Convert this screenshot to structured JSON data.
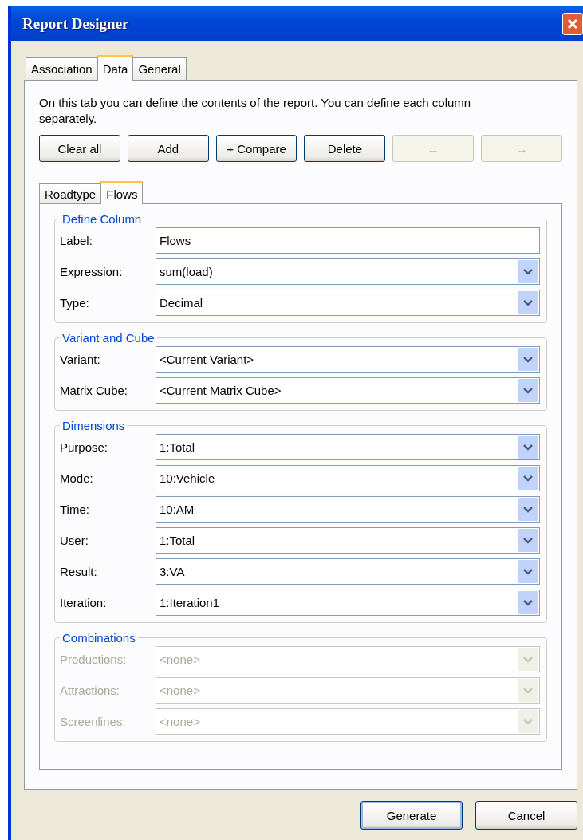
{
  "window": {
    "title": "Report Designer"
  },
  "tabs": [
    {
      "label": "Association",
      "selected": false
    },
    {
      "label": "Data",
      "selected": true
    },
    {
      "label": "General",
      "selected": false
    }
  ],
  "description": "On this tab you can define the contents of the report. You can define each column separately.",
  "toolbar": [
    {
      "label": "Clear all",
      "disabled": false
    },
    {
      "label": "Add",
      "disabled": false
    },
    {
      "label": "+ Compare",
      "disabled": false
    },
    {
      "label": "Delete",
      "disabled": false
    },
    {
      "label": "←",
      "disabled": true
    },
    {
      "label": "→",
      "disabled": true
    }
  ],
  "inner_tabs": [
    {
      "label": "Roadtype",
      "selected": false
    },
    {
      "label": "Flows",
      "selected": true
    }
  ],
  "groups": [
    {
      "title": "Define Column",
      "disabled": false,
      "fields": [
        {
          "label": "Label:",
          "kind": "text",
          "value": "Flows"
        },
        {
          "label": "Expression:",
          "kind": "dropdown",
          "value": "sum(load)"
        },
        {
          "label": "Type:",
          "kind": "dropdown",
          "value": "Decimal"
        }
      ]
    },
    {
      "title": "Variant and Cube",
      "disabled": false,
      "fields": [
        {
          "label": "Variant:",
          "kind": "dropdown",
          "value": "<Current Variant>"
        },
        {
          "label": "Matrix Cube:",
          "kind": "dropdown",
          "value": "<Current Matrix Cube>"
        }
      ]
    },
    {
      "title": "Dimensions",
      "disabled": false,
      "fields": [
        {
          "label": "Purpose:",
          "kind": "dropdown",
          "value": "1:Total"
        },
        {
          "label": "Mode:",
          "kind": "dropdown",
          "value": "10:Vehicle"
        },
        {
          "label": "Time:",
          "kind": "dropdown",
          "value": "10:AM"
        },
        {
          "label": "User:",
          "kind": "dropdown",
          "value": "1:Total"
        },
        {
          "label": "Result:",
          "kind": "dropdown",
          "value": "3:VA"
        },
        {
          "label": "Iteration:",
          "kind": "dropdown",
          "value": "1:Iteration1"
        }
      ]
    },
    {
      "title": "Combinations",
      "disabled": true,
      "fields": [
        {
          "label": "Productions:",
          "kind": "dropdown",
          "value": "<none>"
        },
        {
          "label": "Attractions:",
          "kind": "dropdown",
          "value": "<none>"
        },
        {
          "label": "Screenlines:",
          "kind": "dropdown",
          "value": "<none>"
        }
      ]
    }
  ],
  "buttons": [
    {
      "label": "Generate",
      "default": true
    },
    {
      "label": "Cancel",
      "default": false
    }
  ]
}
